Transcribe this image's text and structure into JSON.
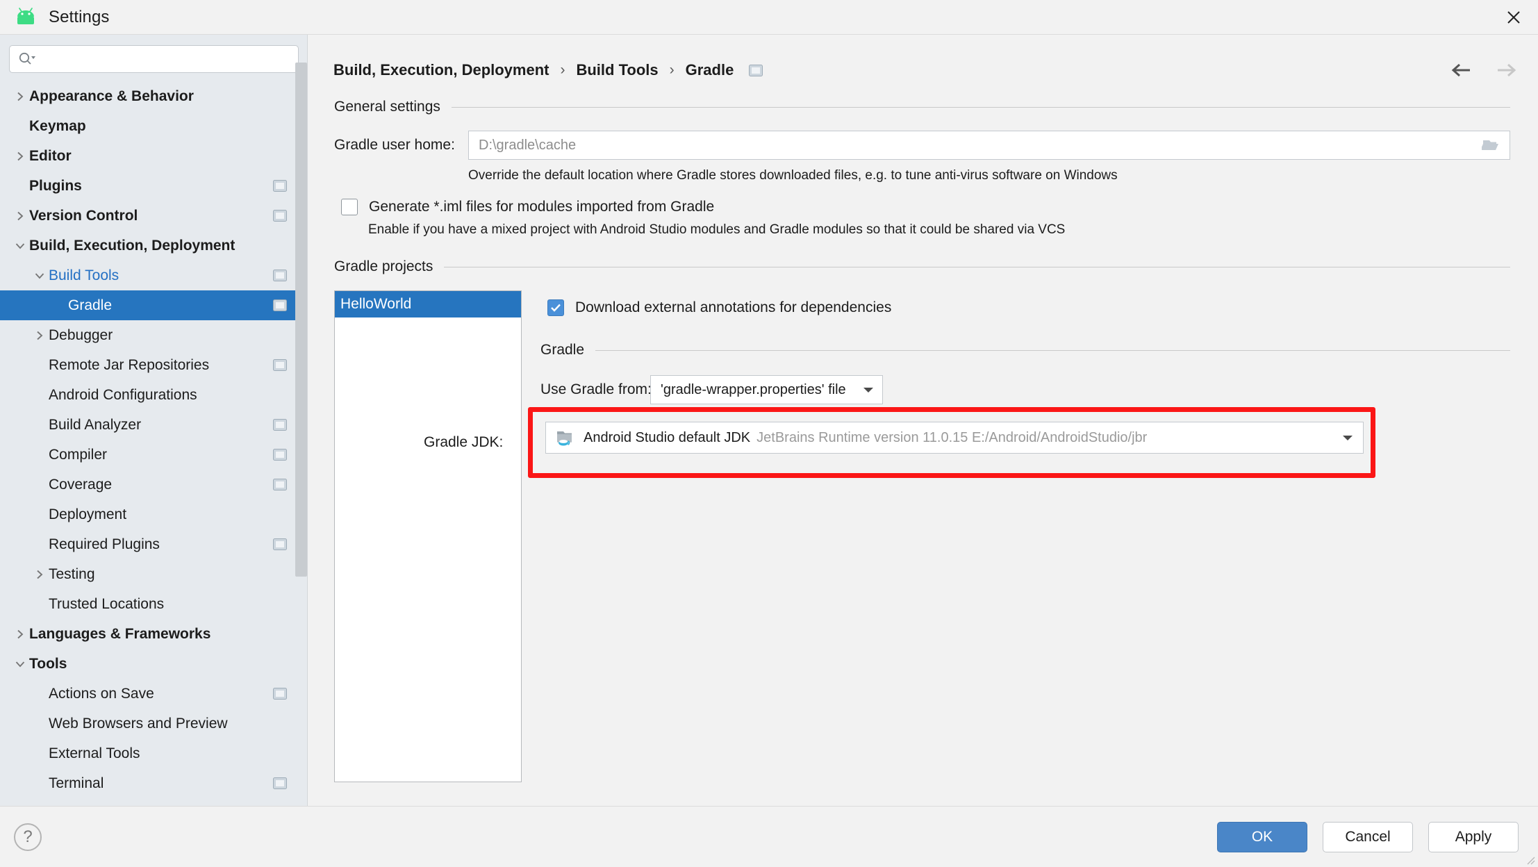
{
  "window": {
    "title": "Settings",
    "app_icon": "android-robot-icon",
    "close_icon": "close-icon",
    "accent_blue": "#2675bf",
    "highlight_red": "#fb1616"
  },
  "sidebar": {
    "search": {
      "placeholder": "",
      "value": "",
      "icon": "search-icon"
    },
    "items": [
      {
        "label": "Appearance & Behavior",
        "level": 0,
        "bold": true,
        "twisty": "chevron-right",
        "badge": false,
        "selected": false
      },
      {
        "label": "Keymap",
        "level": 0,
        "bold": true,
        "twisty": "none",
        "badge": false,
        "selected": false
      },
      {
        "label": "Editor",
        "level": 0,
        "bold": true,
        "twisty": "chevron-right",
        "badge": false,
        "selected": false
      },
      {
        "label": "Plugins",
        "level": 0,
        "bold": true,
        "twisty": "none",
        "badge": true,
        "selected": false
      },
      {
        "label": "Version Control",
        "level": 0,
        "bold": true,
        "twisty": "chevron-right",
        "badge": true,
        "selected": false
      },
      {
        "label": "Build, Execution, Deployment",
        "level": 0,
        "bold": true,
        "twisty": "chevron-down",
        "badge": false,
        "selected": false
      },
      {
        "label": "Build Tools",
        "level": 1,
        "bold": false,
        "twisty": "chevron-down",
        "badge": true,
        "selected": false,
        "link": true
      },
      {
        "label": "Gradle",
        "level": 2,
        "bold": false,
        "twisty": "none",
        "badge": true,
        "selected": true
      },
      {
        "label": "Debugger",
        "level": 1,
        "bold": false,
        "twisty": "chevron-right",
        "badge": false,
        "selected": false
      },
      {
        "label": "Remote Jar Repositories",
        "level": 1,
        "bold": false,
        "twisty": "none",
        "badge": true,
        "selected": false
      },
      {
        "label": "Android Configurations",
        "level": 1,
        "bold": false,
        "twisty": "none",
        "badge": false,
        "selected": false
      },
      {
        "label": "Build Analyzer",
        "level": 1,
        "bold": false,
        "twisty": "none",
        "badge": true,
        "selected": false
      },
      {
        "label": "Compiler",
        "level": 1,
        "bold": false,
        "twisty": "none",
        "badge": true,
        "selected": false
      },
      {
        "label": "Coverage",
        "level": 1,
        "bold": false,
        "twisty": "none",
        "badge": true,
        "selected": false
      },
      {
        "label": "Deployment",
        "level": 1,
        "bold": false,
        "twisty": "none",
        "badge": false,
        "selected": false
      },
      {
        "label": "Required Plugins",
        "level": 1,
        "bold": false,
        "twisty": "none",
        "badge": true,
        "selected": false
      },
      {
        "label": "Testing",
        "level": 1,
        "bold": false,
        "twisty": "chevron-right",
        "badge": false,
        "selected": false
      },
      {
        "label": "Trusted Locations",
        "level": 1,
        "bold": false,
        "twisty": "none",
        "badge": false,
        "selected": false
      },
      {
        "label": "Languages & Frameworks",
        "level": 0,
        "bold": true,
        "twisty": "chevron-right",
        "badge": false,
        "selected": false
      },
      {
        "label": "Tools",
        "level": 0,
        "bold": true,
        "twisty": "chevron-down",
        "badge": false,
        "selected": false
      },
      {
        "label": "Actions on Save",
        "level": 1,
        "bold": false,
        "twisty": "none",
        "badge": true,
        "selected": false
      },
      {
        "label": "Web Browsers and Preview",
        "level": 1,
        "bold": false,
        "twisty": "none",
        "badge": false,
        "selected": false
      },
      {
        "label": "External Tools",
        "level": 1,
        "bold": false,
        "twisty": "none",
        "badge": false,
        "selected": false
      },
      {
        "label": "Terminal",
        "level": 1,
        "bold": false,
        "twisty": "none",
        "badge": true,
        "selected": false
      }
    ]
  },
  "breadcrumb": {
    "parts": [
      "Build, Execution, Deployment",
      "Build Tools",
      "Gradle"
    ],
    "separator": "›",
    "badge_icon": "project-settings-badge-icon",
    "back_icon": "arrow-left-icon",
    "forward_icon": "arrow-right-icon"
  },
  "general_settings": {
    "title": "General settings",
    "gradle_user_home": {
      "label": "Gradle user home:",
      "value": "",
      "placeholder": "D:\\gradle\\cache",
      "browse_icon": "folder-open-icon"
    },
    "gradle_user_home_hint": "Override the default location where Gradle stores downloaded files, e.g. to tune anti-virus software on Windows",
    "generate_iml": {
      "label": "Generate *.iml files for modules imported from Gradle",
      "checked": false
    },
    "generate_iml_hint": "Enable if you have a mixed project with Android Studio modules and Gradle modules so that it could be shared via VCS"
  },
  "gradle_projects": {
    "title": "Gradle projects",
    "list": [
      {
        "label": "HelloWorld",
        "selected": true
      }
    ],
    "download_annotations": {
      "label": "Download external annotations for dependencies",
      "checked": true
    },
    "gradle_section_title": "Gradle",
    "use_gradle_from": {
      "label": "Use Gradle from:",
      "value": "'gradle-wrapper.properties' file",
      "caret_icon": "chevron-down-icon"
    },
    "gradle_jdk": {
      "label": "Gradle JDK:",
      "icon": "jdk-folder-icon",
      "value": "Android Studio default JDK",
      "detail": "JetBrains Runtime version 11.0.15 E:/Android/AndroidStudio/jbr",
      "caret_icon": "chevron-down-icon",
      "highlighted": true
    }
  },
  "footer": {
    "help_label": "?",
    "ok_label": "OK",
    "cancel_label": "Cancel",
    "apply_label": "Apply"
  }
}
